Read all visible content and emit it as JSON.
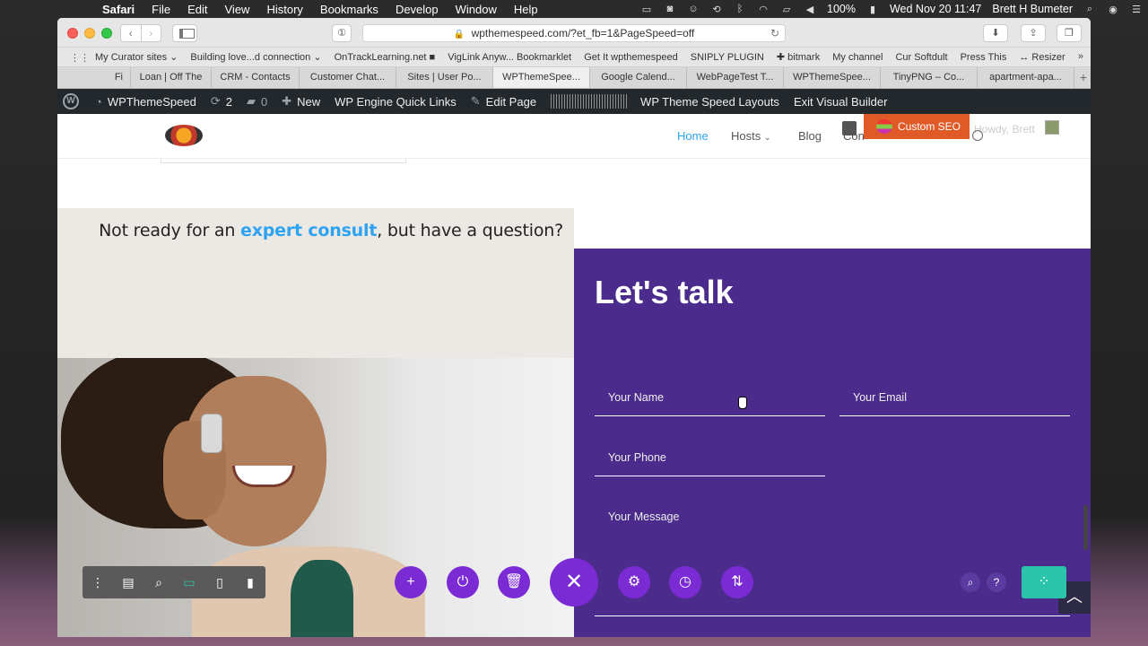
{
  "menubar": {
    "app": "Safari",
    "items": [
      "File",
      "Edit",
      "View",
      "History",
      "Bookmarks",
      "Develop",
      "Window",
      "Help"
    ],
    "battery": "100%",
    "datetime": "Wed Nov 20  11:47",
    "user": "Brett H Bumeter"
  },
  "browser": {
    "url": "wpthemespeed.com/?et_fb=1&PageSpeed=off",
    "bookmarks": [
      "My Curator sites ⌄",
      "Building love...d connection ⌄",
      "OnTrackLearning.net ■",
      "VigLink Anyw... Bookmarklet",
      "Get It wpthemespeed",
      "SNIPLY PLUGIN",
      "✚ bitmark",
      "My channel",
      "Cur Softdult",
      "Press This",
      "↔ Resizer"
    ],
    "tabs": [
      "Fi",
      "Loan | Off The",
      "CRM - Contacts",
      "Customer Chat...",
      "Sites | User Po...",
      "WPThemeSpee...",
      "Google Calend...",
      "WebPageTest T...",
      "WPThemeSpee...",
      "TinyPNG – Co...",
      "apartment-apa..."
    ],
    "active_tab_index": 5
  },
  "wpbar": {
    "site": "WPThemeSpeed",
    "updates": "2",
    "comments": "0",
    "new": "New",
    "quick_links": "WP Engine Quick Links",
    "edit_page": "Edit Page",
    "layouts": "WP Theme Speed Layouts",
    "exit": "Exit Visual Builder"
  },
  "site": {
    "nav": [
      "Home",
      "Hosts",
      "Blog",
      "Con"
    ],
    "custom_seo": "Custom SEO",
    "howdy": "Howdy, Brett",
    "question_prefix": "Not ready for an ",
    "question_highlight": "expert consult",
    "question_suffix": ", but have a question?",
    "form_title": "Let's talk",
    "fields": {
      "name": "Your Name",
      "email": "Your Email",
      "phone": "Your Phone",
      "message": "Your Message"
    }
  },
  "colors": {
    "accent_blue": "#2ea3f2",
    "form_purple": "#4b2c8c",
    "builder_purple": "#7b2bd4",
    "builder_green": "#29c4a9",
    "seo_orange": "#e05a28"
  }
}
